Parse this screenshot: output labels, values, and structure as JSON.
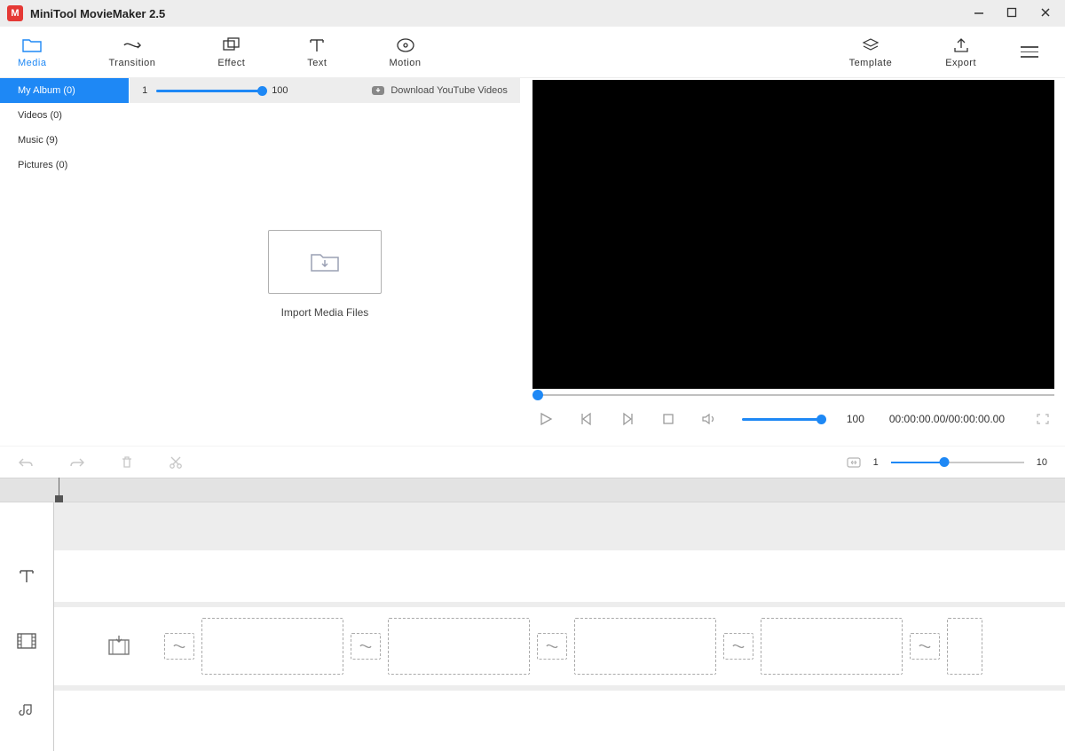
{
  "titlebar": {
    "title": "MiniTool MovieMaker 2.5"
  },
  "toolbar": {
    "media": "Media",
    "transition": "Transition",
    "effect": "Effect",
    "text": "Text",
    "motion": "Motion",
    "template": "Template",
    "export": "Export"
  },
  "sidebar": {
    "my_album": "My Album  (0)",
    "videos": "Videos  (0)",
    "music": "Music  (9)",
    "pictures": "Pictures  (0)"
  },
  "media_header": {
    "min": "1",
    "max": "100",
    "download": "Download YouTube Videos"
  },
  "media_body": {
    "import": "Import Media Files"
  },
  "preview": {
    "vol_max": "100",
    "timecode": "00:00:00.00/00:00:00.00"
  },
  "editbar": {
    "zoom_min": "1",
    "zoom_max": "10"
  }
}
